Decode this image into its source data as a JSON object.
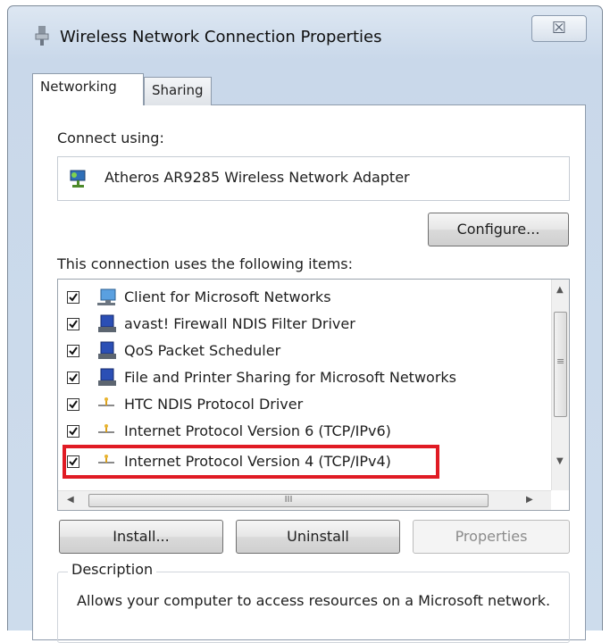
{
  "window": {
    "title": "Wireless Network Connection Properties",
    "close_label": "☒"
  },
  "tabs": [
    {
      "label": "Networking",
      "selected": true
    },
    {
      "label": "Sharing",
      "selected": false
    }
  ],
  "connect_using": {
    "label": "Connect using:",
    "adapter": "Atheros AR9285 Wireless Network Adapter"
  },
  "configure_button": "Configure...",
  "items_label": "This connection uses the following items:",
  "items": [
    {
      "label": "Client for Microsoft Networks",
      "checked": true,
      "icon": "network-client-icon"
    },
    {
      "label": "avast! Firewall NDIS Filter Driver",
      "checked": true,
      "icon": "network-service-icon"
    },
    {
      "label": "QoS Packet Scheduler",
      "checked": true,
      "icon": "network-service-icon"
    },
    {
      "label": "File and Printer Sharing for Microsoft Networks",
      "checked": true,
      "icon": "network-service-icon"
    },
    {
      "label": "HTC NDIS Protocol Driver",
      "checked": true,
      "icon": "protocol-icon"
    },
    {
      "label": "Internet Protocol Version 6 (TCP/IPv6)",
      "checked": true,
      "icon": "protocol-icon"
    },
    {
      "label": "Internet Protocol Version 4 (TCP/IPv4)",
      "checked": true,
      "icon": "protocol-icon",
      "highlighted": true
    }
  ],
  "scroll": {
    "up": "▲",
    "down": "▼",
    "left": "◀",
    "right": "▶",
    "grip_h": "III",
    "grip_v": "≡"
  },
  "buttons": {
    "install": "Install...",
    "uninstall": "Uninstall",
    "properties": "Properties"
  },
  "description": {
    "legend": "Description",
    "text": "Allows your computer to access resources on a Microsoft network."
  },
  "colors": {
    "highlight": "#e01b24",
    "chrome": "#cddcec"
  }
}
